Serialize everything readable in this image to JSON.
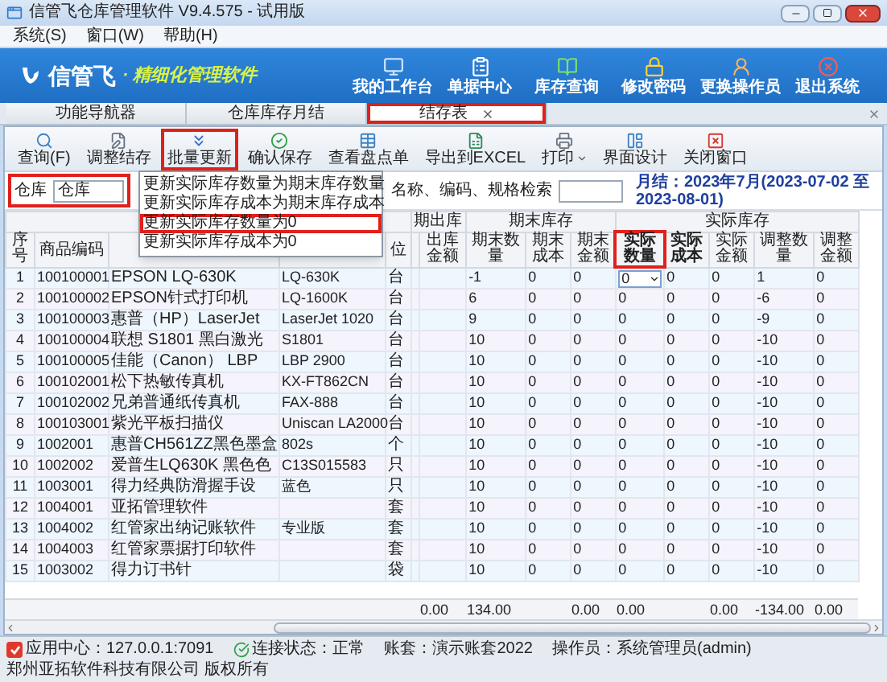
{
  "window": {
    "title": "信管飞仓库管理软件 V9.4.575 - 试用版"
  },
  "menu": [
    "系统(S)",
    "窗口(W)",
    "帮助(H)"
  ],
  "banner": {
    "logo": "信管飞",
    "tagline": "· 精细化管理软件",
    "shortcuts": [
      {
        "kind": "workbench",
        "label": "我的工作台"
      },
      {
        "kind": "documents",
        "label": "单据中心"
      },
      {
        "kind": "inventory",
        "label": "库存查询"
      },
      {
        "kind": "password",
        "label": "修改密码"
      },
      {
        "kind": "operator",
        "label": "更换操作员"
      },
      {
        "kind": "exit",
        "label": "退出系统"
      }
    ]
  },
  "tabs": [
    {
      "label": "功能导航器",
      "selected": false,
      "highlighted": false,
      "closable": false
    },
    {
      "label": "仓库库存月结",
      "selected": false,
      "highlighted": false,
      "closable": false
    },
    {
      "label": "结存表",
      "selected": true,
      "highlighted": true,
      "closable": true
    }
  ],
  "toolbar": [
    {
      "kind": "query",
      "label": "查询(F)",
      "highlighted": false,
      "has_menu": false
    },
    {
      "kind": "adjust",
      "label": "调整结存",
      "highlighted": false,
      "has_menu": false
    },
    {
      "kind": "batch",
      "label": "批量更新",
      "highlighted": true,
      "has_menu": false
    },
    {
      "kind": "save",
      "label": "确认保存",
      "highlighted": false,
      "has_menu": false
    },
    {
      "kind": "count",
      "label": "查看盘点单",
      "highlighted": false,
      "has_menu": false
    },
    {
      "kind": "export",
      "label": "导出到EXCEL",
      "highlighted": false,
      "has_menu": false
    },
    {
      "kind": "print",
      "label": "打印",
      "highlighted": false,
      "has_menu": true
    },
    {
      "kind": "design",
      "label": "界面设计",
      "highlighted": false,
      "has_menu": false
    },
    {
      "kind": "close",
      "label": "关闭窗口",
      "highlighted": false,
      "has_menu": false
    }
  ],
  "batch_menu": [
    {
      "label": "更新实际库存数量为期末库存数量",
      "highlighted": false
    },
    {
      "label": "更新实际库存成本为期末库存成本",
      "highlighted": false
    },
    {
      "label": "更新实际库存数量为0",
      "highlighted": true
    },
    {
      "label": "更新实际库存成本为0",
      "highlighted": false
    }
  ],
  "filter": {
    "warehouse_label": "仓库",
    "warehouse_value": "仓库",
    "highlighted": true,
    "search_label": "名称、编码、规格检索",
    "period": "月结：2023年7月(2023-07-02 至 2023-08-01)"
  },
  "table": {
    "column_groups": [
      "期出库",
      "期末库存",
      "实际库存"
    ],
    "columns": [
      {
        "label": "序号",
        "emphasized": false,
        "highlighted": false
      },
      {
        "label": "商品编码",
        "emphasized": false,
        "highlighted": false
      },
      {
        "covered": true
      },
      {
        "covered": true
      },
      {
        "label": "位",
        "emphasized": false,
        "highlighted": false
      },
      {
        "label": "出库金额",
        "emphasized": false,
        "highlighted": false
      },
      {
        "label": "期末数量",
        "emphasized": false,
        "highlighted": false
      },
      {
        "label": "期末成本",
        "emphasized": false,
        "highlighted": false
      },
      {
        "label": "期末金额",
        "emphasized": false,
        "highlighted": false
      },
      {
        "label": "实际数量",
        "emphasized": true,
        "highlighted": true
      },
      {
        "label": "实际成本",
        "emphasized": true,
        "highlighted": false
      },
      {
        "label": "实际金额",
        "emphasized": false,
        "highlighted": false
      },
      {
        "label": "调整数量",
        "emphasized": false,
        "highlighted": false
      },
      {
        "label": "调整金额",
        "emphasized": false,
        "highlighted": false
      }
    ],
    "rows": [
      {
        "no": "1",
        "code": "100100001",
        "name": "EPSON LQ-630K",
        "spec": "LQ-630K",
        "unit": "台",
        "end_qty": "-1",
        "end_cost": "0",
        "end_amount": "0",
        "actual_qty": "0",
        "actual_cost": "0",
        "actual_amount": "0",
        "adjust_qty": "1",
        "adjust_amount": "0",
        "editing": true
      },
      {
        "no": "2",
        "code": "100100002",
        "name": "EPSON针式打印机",
        "spec": "LQ-1600K",
        "unit": "台",
        "end_qty": "6",
        "end_cost": "0",
        "end_amount": "0",
        "actual_qty": "0",
        "actual_cost": "0",
        "actual_amount": "0",
        "adjust_qty": "-6",
        "adjust_amount": "0",
        "editing": false
      },
      {
        "no": "3",
        "code": "100100003",
        "name": "惠普（HP）LaserJet",
        "spec": "LaserJet 1020",
        "unit": "台",
        "end_qty": "9",
        "end_cost": "0",
        "end_amount": "0",
        "actual_qty": "0",
        "actual_cost": "0",
        "actual_amount": "0",
        "adjust_qty": "-9",
        "adjust_amount": "0",
        "editing": false
      },
      {
        "no": "4",
        "code": "100100004",
        "name": "联想 S1801 黑白激光",
        "spec": "S1801",
        "unit": "台",
        "end_qty": "10",
        "end_cost": "0",
        "end_amount": "0",
        "actual_qty": "0",
        "actual_cost": "0",
        "actual_amount": "0",
        "adjust_qty": "-10",
        "adjust_amount": "0",
        "editing": false
      },
      {
        "no": "5",
        "code": "100100005",
        "name": "佳能（Canon） LBP",
        "spec": "LBP 2900",
        "unit": "台",
        "end_qty": "10",
        "end_cost": "0",
        "end_amount": "0",
        "actual_qty": "0",
        "actual_cost": "0",
        "actual_amount": "0",
        "adjust_qty": "-10",
        "adjust_amount": "0",
        "editing": false
      },
      {
        "no": "6",
        "code": "100102001",
        "name": "松下热敏传真机",
        "spec": "KX-FT862CN",
        "unit": "台",
        "end_qty": "10",
        "end_cost": "0",
        "end_amount": "0",
        "actual_qty": "0",
        "actual_cost": "0",
        "actual_amount": "0",
        "adjust_qty": "-10",
        "adjust_amount": "0",
        "editing": false
      },
      {
        "no": "7",
        "code": "100102002",
        "name": "兄弟普通纸传真机",
        "spec": "FAX-888",
        "unit": "台",
        "end_qty": "10",
        "end_cost": "0",
        "end_amount": "0",
        "actual_qty": "0",
        "actual_cost": "0",
        "actual_amount": "0",
        "adjust_qty": "-10",
        "adjust_amount": "0",
        "editing": false
      },
      {
        "no": "8",
        "code": "100103001",
        "name": "紫光平板扫描仪",
        "spec": "Uniscan LA2000",
        "unit": "台",
        "end_qty": "10",
        "end_cost": "0",
        "end_amount": "0",
        "actual_qty": "0",
        "actual_cost": "0",
        "actual_amount": "0",
        "adjust_qty": "-10",
        "adjust_amount": "0",
        "editing": false
      },
      {
        "no": "9",
        "code": "1002001",
        "name": "惠普CH561ZZ黑色墨盒",
        "spec": "802s",
        "unit": "个",
        "end_qty": "10",
        "end_cost": "0",
        "end_amount": "0",
        "actual_qty": "0",
        "actual_cost": "0",
        "actual_amount": "0",
        "adjust_qty": "-10",
        "adjust_amount": "0",
        "editing": false
      },
      {
        "no": "10",
        "code": "1002002",
        "name": "爱普生LQ630K 黑色色",
        "spec": "C13S015583",
        "unit": "只",
        "end_qty": "10",
        "end_cost": "0",
        "end_amount": "0",
        "actual_qty": "0",
        "actual_cost": "0",
        "actual_amount": "0",
        "adjust_qty": "-10",
        "adjust_amount": "0",
        "editing": false
      },
      {
        "no": "11",
        "code": "1003001",
        "name": "得力经典防滑握手设",
        "spec": "蓝色",
        "unit": "只",
        "end_qty": "10",
        "end_cost": "0",
        "end_amount": "0",
        "actual_qty": "0",
        "actual_cost": "0",
        "actual_amount": "0",
        "adjust_qty": "-10",
        "adjust_amount": "0",
        "editing": false
      },
      {
        "no": "12",
        "code": "1004001",
        "name": "亚拓管理软件",
        "unit": "套",
        "end_qty": "10",
        "end_cost": "0",
        "end_amount": "0",
        "actual_qty": "0",
        "actual_cost": "0",
        "actual_amount": "0",
        "adjust_qty": "-10",
        "adjust_amount": "0",
        "editing": false
      },
      {
        "no": "13",
        "code": "1004002",
        "name": "红管家出纳记账软件",
        "spec": "专业版",
        "unit": "套",
        "end_qty": "10",
        "end_cost": "0",
        "end_amount": "0",
        "actual_qty": "0",
        "actual_cost": "0",
        "actual_amount": "0",
        "adjust_qty": "-10",
        "adjust_amount": "0",
        "editing": false
      },
      {
        "no": "14",
        "code": "1004003",
        "name": "红管家票据打印软件",
        "unit": "套",
        "end_qty": "10",
        "end_cost": "0",
        "end_amount": "0",
        "actual_qty": "0",
        "actual_cost": "0",
        "actual_amount": "0",
        "adjust_qty": "-10",
        "adjust_amount": "0",
        "editing": false
      },
      {
        "no": "15",
        "code": "1003002",
        "name": "得力订书针",
        "unit": "袋",
        "end_qty": "10",
        "end_cost": "0",
        "end_amount": "0",
        "actual_qty": "0",
        "actual_cost": "0",
        "actual_amount": "0",
        "adjust_qty": "-10",
        "adjust_amount": "0",
        "editing": false
      }
    ],
    "summary": {
      "out_amount": "0.00",
      "end_qty": "134.00",
      "end_amount": "0.00",
      "actual_qty": "0.00",
      "actual_amount": "0.00",
      "adjust_qty": "-134.00",
      "adjust_amount": "0.00"
    }
  },
  "status_bar": [
    {
      "kind": "server",
      "text": "应用中心：127.0.0.1:7091"
    },
    {
      "kind": "connection",
      "text": "连接状态：正常"
    },
    {
      "kind": "plain",
      "text": "账套：演示账套2022"
    },
    {
      "kind": "plain",
      "text": "操作员：系统管理员(admin)"
    },
    {
      "kind": "plain",
      "text": "郑州亚拓软件科技有限公司 版权所有"
    }
  ]
}
